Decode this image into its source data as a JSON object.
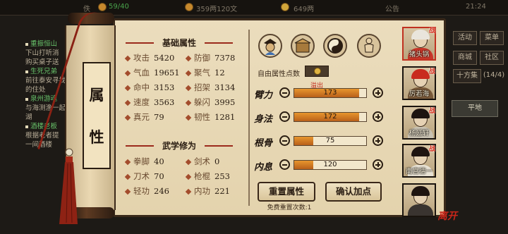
{
  "topbar": {
    "left_text": "佚",
    "stamina": "59/40",
    "money": "359两120文",
    "gold": "649两",
    "announcement": "公告",
    "clock": "21:24"
  },
  "quests": [
    {
      "title": "重振恒山",
      "lines": [
        "下山打听消",
        "购买桌子送"
      ]
    },
    {
      "title": "生死兄弟",
      "lines": [
        "前往泰安寻找",
        "的住处"
      ]
    },
    {
      "title": "泉州游魂",
      "lines": [
        "与海测渔一起",
        "湖"
      ]
    },
    {
      "title": "酒楼老板",
      "lines": [
        "根据老者提",
        "一间酒楼"
      ]
    }
  ],
  "side_buttons": {
    "activity": "活动",
    "stage": "菜单",
    "shop": "商城",
    "chat": "社区",
    "pagination": "十方集",
    "pagination_count": "(14/4)",
    "ground": "平地"
  },
  "scroll": {
    "char1": "属",
    "char2": "性"
  },
  "base_attrs": {
    "title": "基础属性",
    "items": [
      {
        "label": "攻击",
        "value": "5420"
      },
      {
        "label": "防御",
        "value": "7378"
      },
      {
        "label": "气血",
        "value": "19651"
      },
      {
        "label": "聚气",
        "value": "12"
      },
      {
        "label": "命中",
        "value": "3153"
      },
      {
        "label": "招架",
        "value": "3134"
      },
      {
        "label": "速度",
        "value": "3563"
      },
      {
        "label": "躲闪",
        "value": "3995"
      },
      {
        "label": "真元",
        "value": "79"
      },
      {
        "label": "韧性",
        "value": "1281"
      }
    ]
  },
  "martial_arts": {
    "title": "武学修为",
    "items": [
      {
        "label": "拳脚",
        "value": "40"
      },
      {
        "label": "剑术",
        "value": "0"
      },
      {
        "label": "刀术",
        "value": "70"
      },
      {
        "label": "枪棍",
        "value": "253"
      },
      {
        "label": "轻功",
        "value": "246"
      },
      {
        "label": "内功",
        "value": "221"
      }
    ]
  },
  "free_points": {
    "label": "自由属性点数",
    "value": "0"
  },
  "overflow_label": "溢出",
  "attributes": [
    {
      "name": "臂力",
      "value": "173",
      "fill": 0.9
    },
    {
      "name": "身法",
      "value": "172",
      "fill": 0.9
    },
    {
      "name": "根骨",
      "value": "75",
      "fill": 0.26
    },
    {
      "name": "内息",
      "value": "120",
      "fill": 0.26
    }
  ],
  "buttons": {
    "reset": "重置属性",
    "confirm": "确认加点",
    "reset_note": "免费重置次数:1"
  },
  "party": [
    {
      "name": "猪头锅",
      "tag": "战",
      "active": true
    },
    {
      "name": "厉若海",
      "tag": "战",
      "active": false
    },
    {
      "name": "杨延轩",
      "tag": "战",
      "active": false
    },
    {
      "name": "南宫德一",
      "tag": "战",
      "active": false
    },
    {
      "name": "",
      "tag": "",
      "active": false
    }
  ],
  "close_label": "离开",
  "colors": {
    "accent_red": "#c03120",
    "bar_orange": "#d9822b",
    "panel": "#e7d8b4"
  }
}
